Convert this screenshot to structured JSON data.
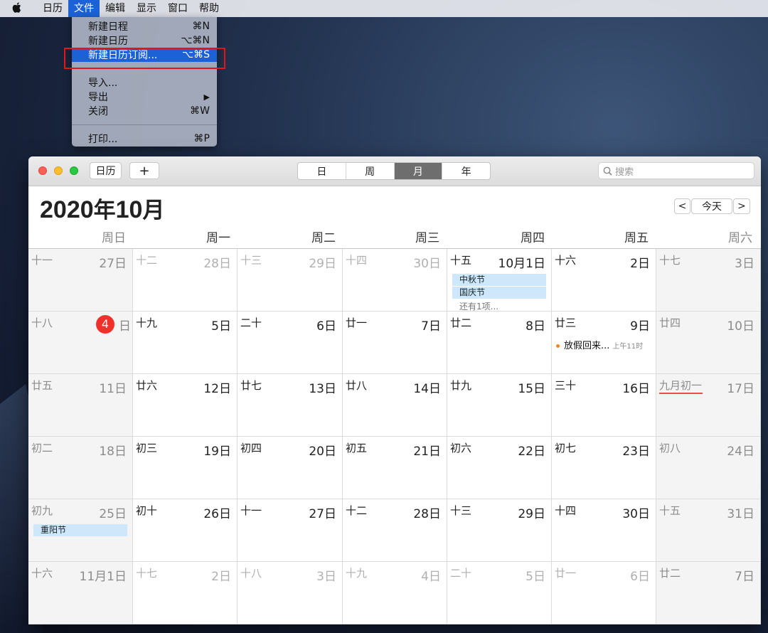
{
  "menubar": {
    "apple_icon": "",
    "items": [
      "日历",
      "文件",
      "编辑",
      "显示",
      "窗口",
      "帮助"
    ]
  },
  "file_menu": {
    "items": [
      {
        "label": "新建日程",
        "shortcut": "⌘N"
      },
      {
        "label": "新建日历",
        "shortcut": "⌥⌘N"
      },
      {
        "label": "新建日历订阅...",
        "shortcut": "⌥⌘S"
      },
      {
        "label": "导入...",
        "shortcut": ""
      },
      {
        "label": "导出",
        "shortcut": "▶"
      },
      {
        "label": "关闭",
        "shortcut": "⌘W"
      },
      {
        "label": "打印...",
        "shortcut": "⌘P"
      }
    ]
  },
  "toolbar": {
    "calendars_button": "日历",
    "add_button": "+",
    "views": [
      "日",
      "周",
      "月",
      "年"
    ],
    "active_view": "月",
    "search_placeholder": "搜索"
  },
  "month": {
    "year": "2020",
    "year_suffix": "年",
    "month": "10",
    "month_suffix": "月",
    "today_button": "今天",
    "prev": "<",
    "next": ">"
  },
  "weekdays": [
    "周日",
    "周一",
    "周二",
    "周三",
    "周四",
    "周五",
    "周六"
  ],
  "weeks": [
    [
      {
        "lunar": "十一",
        "day": "27日",
        "other": true
      },
      {
        "lunar": "十二",
        "day": "28日",
        "other": true
      },
      {
        "lunar": "十三",
        "day": "29日",
        "other": true
      },
      {
        "lunar": "十四",
        "day": "30日",
        "other": true
      },
      {
        "lunar": "十五",
        "day": "10月1日",
        "events": [
          "中秋节",
          "国庆节"
        ],
        "more": "还有1项..."
      },
      {
        "lunar": "十六",
        "day": "2日"
      },
      {
        "lunar": "十七",
        "day": "3日"
      }
    ],
    [
      {
        "lunar": "十八",
        "day": "日",
        "today": "4"
      },
      {
        "lunar": "十九",
        "day": "5日"
      },
      {
        "lunar": "二十",
        "day": "6日"
      },
      {
        "lunar": "廿一",
        "day": "7日"
      },
      {
        "lunar": "廿二",
        "day": "8日"
      },
      {
        "lunar": "廿三",
        "day": "9日",
        "timed_event": {
          "title": "放假回来...",
          "time": "上午11时"
        }
      },
      {
        "lunar": "廿四",
        "day": "10日"
      }
    ],
    [
      {
        "lunar": "廿五",
        "day": "11日"
      },
      {
        "lunar": "廿六",
        "day": "12日"
      },
      {
        "lunar": "廿七",
        "day": "13日"
      },
      {
        "lunar": "廿八",
        "day": "14日"
      },
      {
        "lunar": "廿九",
        "day": "15日"
      },
      {
        "lunar": "三十",
        "day": "16日"
      },
      {
        "lunar": "九月初一",
        "day": "17日",
        "underline": true
      }
    ],
    [
      {
        "lunar": "初二",
        "day": "18日"
      },
      {
        "lunar": "初三",
        "day": "19日"
      },
      {
        "lunar": "初四",
        "day": "20日"
      },
      {
        "lunar": "初五",
        "day": "21日"
      },
      {
        "lunar": "初六",
        "day": "22日"
      },
      {
        "lunar": "初七",
        "day": "23日"
      },
      {
        "lunar": "初八",
        "day": "24日"
      }
    ],
    [
      {
        "lunar": "初九",
        "day": "25日",
        "events": [
          "重阳节"
        ]
      },
      {
        "lunar": "初十",
        "day": "26日"
      },
      {
        "lunar": "十一",
        "day": "27日"
      },
      {
        "lunar": "十二",
        "day": "28日"
      },
      {
        "lunar": "十三",
        "day": "29日"
      },
      {
        "lunar": "十四",
        "day": "30日"
      },
      {
        "lunar": "十五",
        "day": "31日"
      }
    ],
    [
      {
        "lunar": "十六",
        "day": "11月1日",
        "other": true
      },
      {
        "lunar": "十七",
        "day": "2日",
        "other": true
      },
      {
        "lunar": "十八",
        "day": "3日",
        "other": true
      },
      {
        "lunar": "十九",
        "day": "4日",
        "other": true
      },
      {
        "lunar": "二十",
        "day": "5日",
        "other": true
      },
      {
        "lunar": "廿一",
        "day": "6日",
        "other": true
      },
      {
        "lunar": "廿二",
        "day": "7日",
        "other": true
      }
    ]
  ],
  "colors": {
    "menu_highlight": "#1c62d6",
    "today_red": "#f0302b",
    "event_blue": "#cfe7fb",
    "annotation_box": "#e0161b"
  }
}
